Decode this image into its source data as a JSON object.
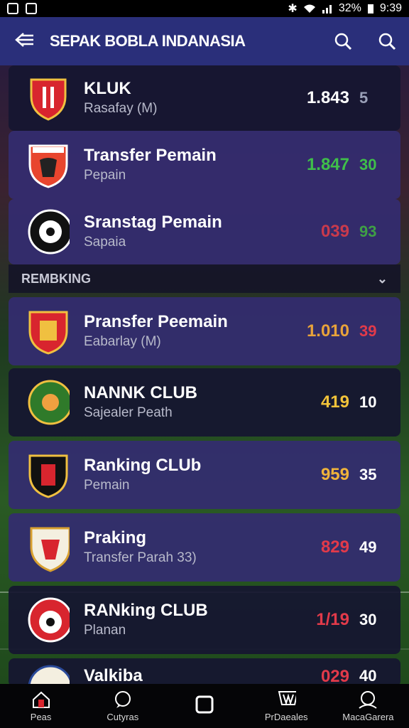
{
  "status_bar": {
    "battery": "32%",
    "time": "9:39"
  },
  "header": {
    "title": "SEPAK BOBLA INDANASIA"
  },
  "rows": [
    {
      "name": "KLUK",
      "sub": "Rasafay (M)",
      "v1": "1.843",
      "v2": "5",
      "v1_color": "#ffffff",
      "v2_color": "#9aa0b8"
    },
    {
      "name": "Transfer Pemain",
      "sub": "Pepain",
      "v1": "1.847",
      "v2": "30",
      "v1_color": "#3fbf4a",
      "v2_color": "#3fbf4a"
    },
    {
      "name": "Sranstag Pemain",
      "sub": "Sapaia",
      "v1": "039",
      "v2": "93",
      "v1_color": "#c93a4c",
      "v2_color": "#3fa045"
    },
    {
      "name": "Pransfer Peemain",
      "sub": "Eabarlay (M)",
      "v1": "1.010",
      "v2": "39",
      "v1_color": "#e8a33a",
      "v2_color": "#e23a4a"
    },
    {
      "name": "NANNK CLUB",
      "sub": "Sajealer Peath",
      "v1": "419",
      "v2": "10",
      "v1_color": "#f2c33a",
      "v2_color": "#ffffff"
    },
    {
      "name": "Ranking CLUb",
      "sub": "Pemain",
      "v1": "959",
      "v2": "35",
      "v1_color": "#f0b43a",
      "v2_color": "#ffffff"
    },
    {
      "name": "Praking",
      "sub": "Transfer Parah 33)",
      "v1": "829",
      "v2": "49",
      "v1_color": "#e23a4a",
      "v2_color": "#ffffff"
    },
    {
      "name": "RANking CLUB",
      "sub": "Planan",
      "v1": "1/19",
      "v2": "30",
      "v1_color": "#e23a4a",
      "v2_color": "#ffffff"
    },
    {
      "name": "Valkiba",
      "sub": "",
      "v1": "029",
      "v2": "40",
      "v1_color": "#e23a4a",
      "v2_color": "#ffffff"
    }
  ],
  "section": {
    "label": "REMBKING"
  },
  "nav": [
    {
      "label": "Peas"
    },
    {
      "label": "Cutyras"
    },
    {
      "label": ""
    },
    {
      "label": "PrDaeales"
    },
    {
      "label": "MacaGarera"
    }
  ]
}
